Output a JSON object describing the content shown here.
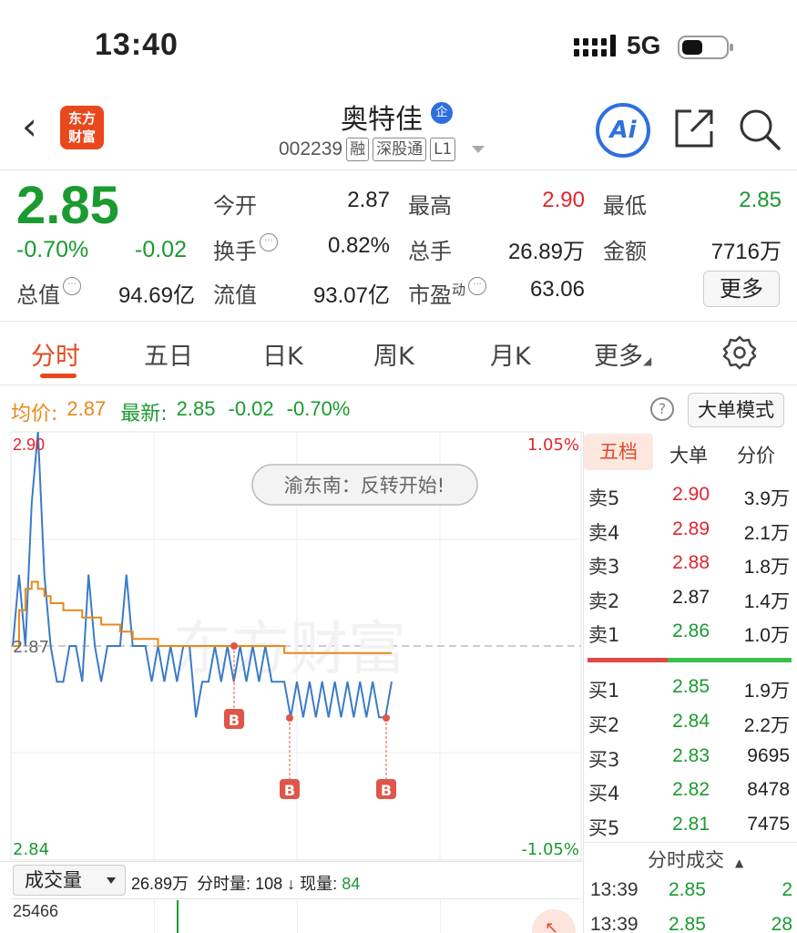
{
  "status": {
    "time": "13:40",
    "network": "5G"
  },
  "nav": {
    "logo_line1": "东方",
    "logo_line2": "财富",
    "stock_name": "奥特佳",
    "badge": "企",
    "code": "002239",
    "tags": [
      "融",
      "深股通",
      "L1"
    ],
    "ai_label": "Ai"
  },
  "quote": {
    "price": "2.85",
    "pct": "-0.70%",
    "change": "-0.02",
    "rows": [
      [
        {
          "label": "今开",
          "value": "2.87",
          "color": "#222"
        },
        {
          "label": "最高",
          "value": "2.90",
          "color": "#e0252f"
        },
        {
          "label": "最低",
          "value": "2.85",
          "color": "#1a9a30"
        }
      ],
      [
        {
          "label": "换手",
          "value": "0.82%",
          "color": "#222"
        },
        {
          "label": "总手",
          "value": "26.89万",
          "color": "#222"
        },
        {
          "label": "金额",
          "value": "7716万",
          "color": "#222"
        }
      ]
    ],
    "market_cap_label": "总值",
    "market_cap": "94.69亿",
    "float_cap_label": "流值",
    "float_cap": "93.07亿",
    "pe_label": "市盈",
    "pe_sup": "动",
    "pe": "63.06",
    "more_label": "更多"
  },
  "tabs": [
    "分时",
    "五日",
    "日K",
    "周K",
    "月K",
    "更多"
  ],
  "avg_row": {
    "avg_label": "均价:",
    "avg_value": "2.87",
    "latest_label": "最新:",
    "latest_value": "2.85",
    "latest_change": "-0.02",
    "latest_pct": "-0.70%",
    "help": "?",
    "big_order_mode": "大单模式"
  },
  "chart_data": {
    "type": "line",
    "ylim": [
      2.84,
      2.9
    ],
    "y_labels": {
      "top": "2.90",
      "mid": "2.87",
      "bottom": "2.84",
      "top_pct": "1.05%",
      "bottom_pct": "-1.05%"
    },
    "annotation": "渝东南：反转开始!",
    "buy_marker": "B",
    "series": [
      {
        "color": "#3a7bc8",
        "values": [
          2.87,
          2.88,
          2.87,
          2.89,
          2.9,
          2.88,
          2.87,
          2.865,
          2.865,
          2.87,
          2.87,
          2.865,
          2.88,
          2.87,
          2.865,
          2.87,
          2.87,
          2.87,
          2.88,
          2.87,
          2.87,
          2.87,
          2.865,
          2.87,
          2.865,
          2.87,
          2.865,
          2.87,
          2.87,
          2.86,
          2.865,
          2.865,
          2.87,
          2.865,
          2.87,
          2.865,
          2.87,
          2.865,
          2.87,
          2.865,
          2.87,
          2.865,
          2.865,
          2.865,
          2.86,
          2.865,
          2.86,
          2.865,
          2.86,
          2.865,
          2.86,
          2.865,
          2.86,
          2.865,
          2.86,
          2.865,
          2.86,
          2.865,
          2.86,
          2.86,
          2.865
        ]
      },
      {
        "color": "#e8891a",
        "values": [
          2.87,
          2.875,
          2.878,
          2.879,
          2.878,
          2.877,
          2.876,
          2.876,
          2.875,
          2.875,
          2.875,
          2.874,
          2.874,
          2.874,
          2.873,
          2.873,
          2.873,
          2.872,
          2.872,
          2.871,
          2.871,
          2.871,
          2.871,
          2.87,
          2.87,
          2.87,
          2.87,
          2.87,
          2.87,
          2.87,
          2.87,
          2.87,
          2.87,
          2.87,
          2.87,
          2.87,
          2.87,
          2.87,
          2.87,
          2.87,
          2.87,
          2.87,
          2.87,
          2.869,
          2.869,
          2.869,
          2.869,
          2.869,
          2.869,
          2.869,
          2.869,
          2.869,
          2.869,
          2.869,
          2.869,
          2.869,
          2.869,
          2.869,
          2.869,
          2.869,
          2.869
        ]
      }
    ]
  },
  "order_book": {
    "tabs": [
      "五档",
      "大单",
      "分价"
    ],
    "asks": [
      {
        "label": "卖5",
        "price": "2.90",
        "vol": "3.9万",
        "color": "#e0252f"
      },
      {
        "label": "卖4",
        "price": "2.89",
        "vol": "2.1万",
        "color": "#e0252f"
      },
      {
        "label": "卖3",
        "price": "2.88",
        "vol": "1.8万",
        "color": "#e0252f"
      },
      {
        "label": "卖2",
        "price": "2.87",
        "vol": "1.4万",
        "color": "#222"
      },
      {
        "label": "卖1",
        "price": "2.86",
        "vol": "1.0万",
        "color": "#1a9a30"
      }
    ],
    "bids": [
      {
        "label": "买1",
        "price": "2.85",
        "vol": "1.9万",
        "color": "#1a9a30"
      },
      {
        "label": "买2",
        "price": "2.84",
        "vol": "2.2万",
        "color": "#1a9a30"
      },
      {
        "label": "买3",
        "price": "2.83",
        "vol": "9695",
        "color": "#1a9a30"
      },
      {
        "label": "买4",
        "price": "2.82",
        "vol": "8478",
        "color": "#1a9a30"
      },
      {
        "label": "买5",
        "price": "2.81",
        "vol": "7475",
        "color": "#1a9a30"
      }
    ]
  },
  "ticks": {
    "title": "分时成交",
    "rows": [
      {
        "time": "13:39",
        "price": "2.85",
        "vol": "2"
      },
      {
        "time": "13:39",
        "price": "2.85",
        "vol": "28"
      }
    ]
  },
  "volume": {
    "select": "成交量",
    "total": "26.89万",
    "minute_label": "分时量:",
    "minute_value": "108",
    "arrow": "↓",
    "now_label": "现量:",
    "now_value": "84",
    "max": "25466"
  }
}
